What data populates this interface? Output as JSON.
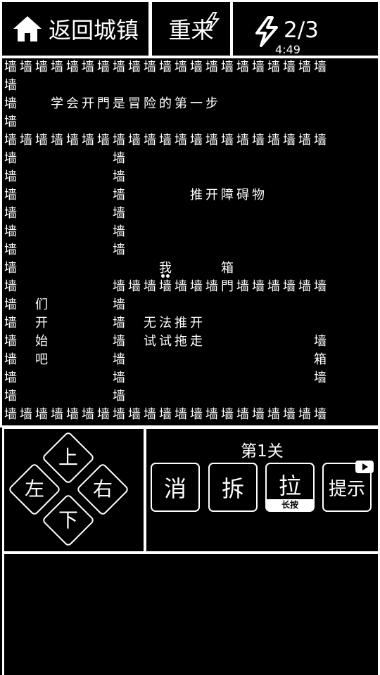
{
  "top_bar": {
    "home_label": "返回城镇",
    "restart_label": "重来",
    "energy_count": "2/3",
    "energy_timer": "4:49"
  },
  "map": {
    "wall": "墙",
    "rows": [
      {
        "row": 0,
        "cells": [
          [
            0,
            20,
            "墙"
          ]
        ]
      },
      {
        "row": 1,
        "cells": [
          [
            0,
            0,
            "墙"
          ]
        ]
      },
      {
        "row": 2,
        "cells": [
          [
            0,
            0,
            "墙"
          ],
          [
            3,
            3,
            "学"
          ],
          [
            4,
            4,
            "会"
          ],
          [
            5,
            5,
            "开"
          ],
          [
            6,
            6,
            "門"
          ],
          [
            7,
            7,
            "是"
          ],
          [
            8,
            8,
            "冒"
          ],
          [
            9,
            9,
            "险"
          ],
          [
            10,
            10,
            "的"
          ],
          [
            11,
            11,
            "第"
          ],
          [
            12,
            12,
            "一"
          ],
          [
            13,
            13,
            "步"
          ]
        ]
      },
      {
        "row": 3,
        "cells": [
          [
            0,
            0,
            "墙"
          ]
        ]
      },
      {
        "row": 4,
        "cells": [
          [
            0,
            20,
            "墙"
          ]
        ]
      },
      {
        "row": 5,
        "cells": [
          [
            0,
            0,
            "墙"
          ],
          [
            7,
            7,
            "墙"
          ]
        ]
      },
      {
        "row": 6,
        "cells": [
          [
            0,
            0,
            "墙"
          ],
          [
            7,
            7,
            "墙"
          ]
        ]
      },
      {
        "row": 7,
        "cells": [
          [
            0,
            0,
            "墙"
          ],
          [
            7,
            7,
            "墙"
          ],
          [
            12,
            12,
            "推"
          ],
          [
            13,
            13,
            "开"
          ],
          [
            14,
            14,
            "障"
          ],
          [
            15,
            15,
            "碍"
          ],
          [
            16,
            16,
            "物"
          ]
        ]
      },
      {
        "row": 8,
        "cells": [
          [
            0,
            0,
            "墙"
          ],
          [
            7,
            7,
            "墙"
          ]
        ]
      },
      {
        "row": 9,
        "cells": [
          [
            0,
            0,
            "墙"
          ],
          [
            7,
            7,
            "墙"
          ]
        ]
      },
      {
        "row": 10,
        "cells": [
          [
            0,
            0,
            "墙"
          ],
          [
            7,
            7,
            "墙"
          ]
        ]
      },
      {
        "row": 11,
        "cells": [
          [
            0,
            0,
            "墙"
          ],
          [
            10,
            10,
            "我"
          ],
          [
            14,
            14,
            "箱"
          ]
        ]
      },
      {
        "row": 12,
        "cells": [
          [
            0,
            0,
            "墙"
          ],
          [
            7,
            13,
            "墙"
          ],
          [
            14,
            14,
            "門"
          ],
          [
            15,
            20,
            "墙"
          ]
        ]
      },
      {
        "row": 13,
        "cells": [
          [
            0,
            0,
            "墙"
          ],
          [
            2,
            2,
            "们"
          ],
          [
            7,
            7,
            "墙"
          ]
        ]
      },
      {
        "row": 14,
        "cells": [
          [
            0,
            0,
            "墙"
          ],
          [
            2,
            2,
            "开"
          ],
          [
            7,
            7,
            "墙"
          ],
          [
            9,
            9,
            "无"
          ],
          [
            10,
            10,
            "法"
          ],
          [
            11,
            11,
            "推"
          ],
          [
            12,
            12,
            "开"
          ]
        ]
      },
      {
        "row": 15,
        "cells": [
          [
            0,
            0,
            "墙"
          ],
          [
            2,
            2,
            "始"
          ],
          [
            7,
            7,
            "墙"
          ],
          [
            9,
            9,
            "试"
          ],
          [
            10,
            10,
            "试"
          ],
          [
            11,
            11,
            "拖"
          ],
          [
            12,
            12,
            "走"
          ],
          [
            20,
            20,
            "墙"
          ]
        ]
      },
      {
        "row": 16,
        "cells": [
          [
            0,
            0,
            "墙"
          ],
          [
            2,
            2,
            "吧"
          ],
          [
            7,
            7,
            "墙"
          ],
          [
            20,
            20,
            "箱"
          ]
        ]
      },
      {
        "row": 17,
        "cells": [
          [
            0,
            0,
            "墙"
          ],
          [
            7,
            7,
            "墙"
          ],
          [
            20,
            20,
            "墙"
          ]
        ]
      },
      {
        "row": 18,
        "cells": [
          [
            0,
            0,
            "墙"
          ],
          [
            7,
            7,
            "墙"
          ]
        ]
      },
      {
        "row": 19,
        "cells": [
          [
            0,
            20,
            "墙"
          ]
        ]
      }
    ],
    "player": {
      "col": 10,
      "row": 11
    }
  },
  "dpad": {
    "up": "上",
    "left": "左",
    "right": "右",
    "down": "下"
  },
  "tools": {
    "level_label": "第1关",
    "eliminate": "消",
    "demolish": "拆",
    "pull": "拉",
    "pull_sub": "长按",
    "hint": "提示"
  },
  "colors": {
    "background": "#000000",
    "foreground": "#ffffff"
  }
}
